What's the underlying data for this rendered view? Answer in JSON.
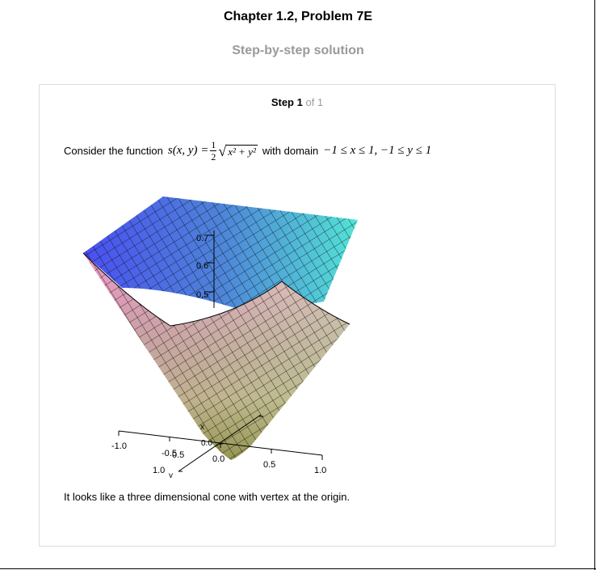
{
  "header": {
    "chapter_title": "Chapter 1.2, Problem 7E",
    "subtitle": "Step-by-step solution"
  },
  "step": {
    "label": "Step 1",
    "of": "of 1"
  },
  "content": {
    "intro": "Consider the function",
    "function_lhs": "s(x, y) =",
    "function_coef_num": "1",
    "function_coef_den": "2",
    "function_radicand": "x² + y²",
    "domain_label": "with domain",
    "domain_expr": "−1 ≤ x ≤ 1, −1 ≤ y ≤ 1",
    "conclusion": "It looks like a three dimensional cone with vertex at the origin."
  },
  "plot": {
    "x_ticks": [
      "-1.0",
      "-0.5",
      "0.0",
      "0.5",
      "1.0"
    ],
    "y_ticks": [
      "1.0",
      "0.5",
      "0.0"
    ],
    "z_ticks": [
      "0.7",
      "0.6",
      "0.5"
    ],
    "x_axis_label": "x",
    "y_axis_label": "y",
    "colors": {
      "back_left": "#4a4ff0",
      "back_right": "#53e3d6",
      "front_left": "#f39acb",
      "front_right": "#dff7c9",
      "vertex": "#9f9a44"
    }
  }
}
